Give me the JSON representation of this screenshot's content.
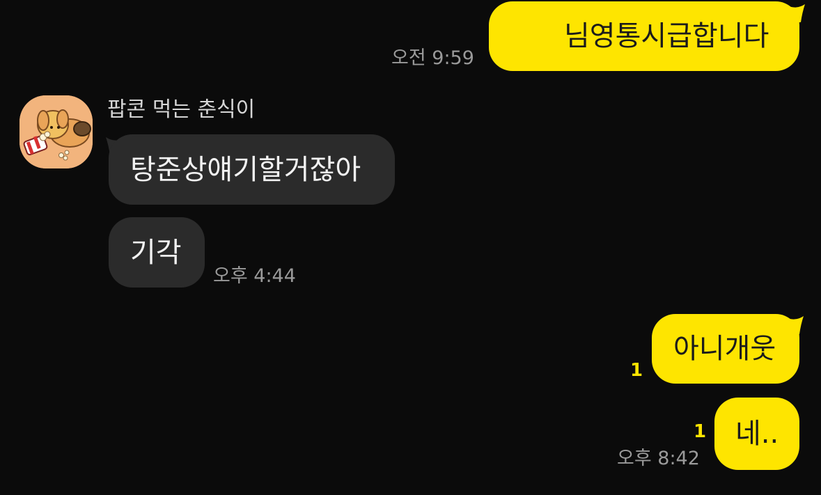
{
  "colors": {
    "background": "#0b0b0b",
    "my_bubble": "#fee500",
    "their_bubble": "#2b2b2b",
    "timestamp": "#9a9a9a",
    "unread_count": "#fee500"
  },
  "messages": [
    {
      "sender": "me",
      "text": "님영통시급합니다",
      "time": "오전 9:59"
    },
    {
      "sender": "팝콘 먹는 춘식이",
      "text": "탕준상얘기할거잖아"
    },
    {
      "sender": "팝콘 먹는 춘식이",
      "text": "기각",
      "time": "오후 4:44"
    },
    {
      "sender": "me",
      "text": "아니개웃",
      "unread": "1"
    },
    {
      "sender": "me",
      "text": "네..",
      "unread": "1",
      "time": "오후 8:42"
    }
  ],
  "contact": {
    "name": "팝콘 먹는 춘식이",
    "avatar_icon": "choonsik-popcorn-avatar-icon"
  }
}
